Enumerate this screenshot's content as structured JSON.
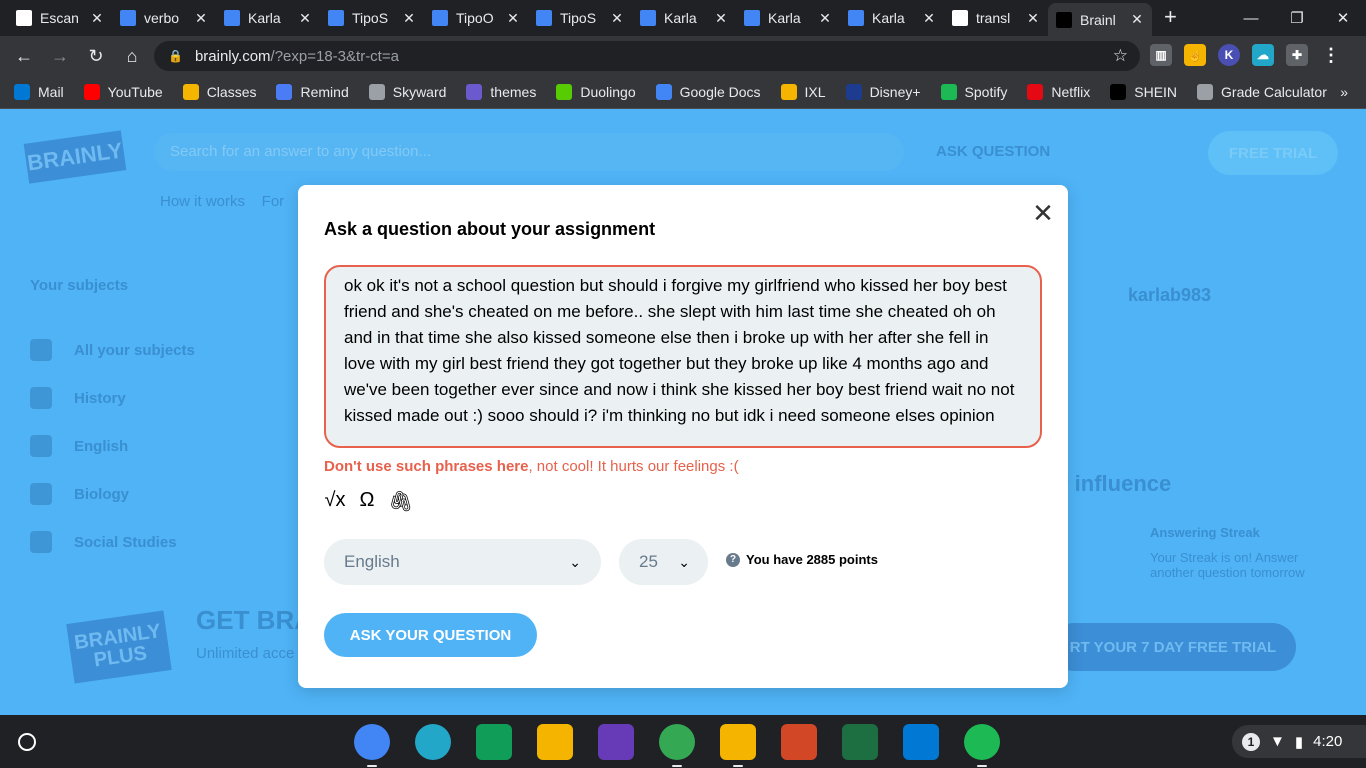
{
  "tabs": [
    {
      "title": "Escan",
      "color": "#ffffff"
    },
    {
      "title": "verbo",
      "color": "#4285f4"
    },
    {
      "title": "Karla",
      "color": "#4285f4"
    },
    {
      "title": "TipoS",
      "color": "#4285f4"
    },
    {
      "title": "TipoO",
      "color": "#4285f4"
    },
    {
      "title": "TipoS",
      "color": "#4285f4"
    },
    {
      "title": "Karla",
      "color": "#4285f4"
    },
    {
      "title": "Karla",
      "color": "#4285f4"
    },
    {
      "title": "Karla",
      "color": "#4285f4"
    },
    {
      "title": "transl",
      "color": "#ffffff"
    },
    {
      "title": "Brainl",
      "color": "#000000"
    }
  ],
  "address": {
    "domain": "brainly.com",
    "path": "/?exp=18-3&tr-ct=a"
  },
  "bookmarks": [
    {
      "label": "Mail",
      "color": "#0078d4"
    },
    {
      "label": "YouTube",
      "color": "#ff0000"
    },
    {
      "label": "Classes",
      "color": "#f4b400"
    },
    {
      "label": "Remind",
      "color": "#4a7cf6"
    },
    {
      "label": "Skyward",
      "color": "#9aa0a6"
    },
    {
      "label": "themes",
      "color": "#6a5acd"
    },
    {
      "label": "Duolingo",
      "color": "#58cc02"
    },
    {
      "label": "Google Docs",
      "color": "#4285f4"
    },
    {
      "label": "IXL",
      "color": "#f4b400"
    },
    {
      "label": "Disney+",
      "color": "#1d3c8f"
    },
    {
      "label": "Spotify",
      "color": "#1db954"
    },
    {
      "label": "Netflix",
      "color": "#e50914"
    },
    {
      "label": "SHEIN",
      "color": "#000000"
    },
    {
      "label": "Grade Calculator",
      "color": "#9aa0a6"
    }
  ],
  "bookmarks_more": "»",
  "background": {
    "logo": "BRAINLY",
    "search_placeholder": "Search for an answer to any question...",
    "ask_question": "ASK QUESTION",
    "free_trial": "FREE TRIAL",
    "nav": "How it works    For",
    "sidebar_title": "Your subjects",
    "subjects": [
      "All your subjects",
      "History",
      "English",
      "Biology",
      "Social Studies"
    ],
    "username": "karlab983",
    "influence": "r influence",
    "streak_title": "Answering Streak",
    "streak_text": "Your Streak is on! Answer another question tomorrow",
    "plus_title": "GET BRA",
    "plus_sub": "Unlimited acce",
    "plus_logo": "BRAINLY PLUS",
    "plus_button": "RT YOUR 7 DAY FREE TRIAL"
  },
  "modal": {
    "title": "Ask a question about your assignment",
    "question_text": "ok ok it's not a school question but should i forgive my girlfriend who kissed her boy best friend and she's cheated on me before.. she slept with him last time she cheated oh oh and in that time she also kissed someone else then i broke up with her after she fell in love with my girl best friend they got together but they broke up like 4 months ago and we've been together ever since and now i think she kissed her boy best friend wait no not kissed made out :) sooo should i? i'm thinking no but idk i need someone elses opinion",
    "warning_bold": "Don't use such phrases here",
    "warning_rest": ", not cool! It hurts our feelings :(",
    "tool_icons": [
      "formula-icon",
      "omega-icon",
      "attachment-icon"
    ],
    "language": "English",
    "points": "25",
    "points_info": "You have 2885 points",
    "submit_label": "ASK YOUR QUESTION"
  },
  "taskbar": {
    "apps": [
      {
        "name": "chrome-icon",
        "color": "#4285f4"
      },
      {
        "name": "files-icon",
        "color": "#22a7c9"
      },
      {
        "name": "sheets-icon",
        "color": "#0f9d58"
      },
      {
        "name": "keep-icon",
        "color": "#f4b400"
      },
      {
        "name": "forms-icon",
        "color": "#673ab7"
      },
      {
        "name": "drive-icon",
        "color": "#34a853"
      },
      {
        "name": "classroom-icon",
        "color": "#f4b400"
      },
      {
        "name": "powerpoint-icon",
        "color": "#d24726"
      },
      {
        "name": "excel-icon",
        "color": "#1d6f42"
      },
      {
        "name": "outlook-icon",
        "color": "#0078d4"
      },
      {
        "name": "spotify-icon",
        "color": "#1db954"
      }
    ],
    "notification_count": "1",
    "time": "4:20"
  },
  "colors": {
    "accent": "#4fb3f6",
    "error": "#e7614c",
    "field_bg": "#ebf0f3"
  }
}
